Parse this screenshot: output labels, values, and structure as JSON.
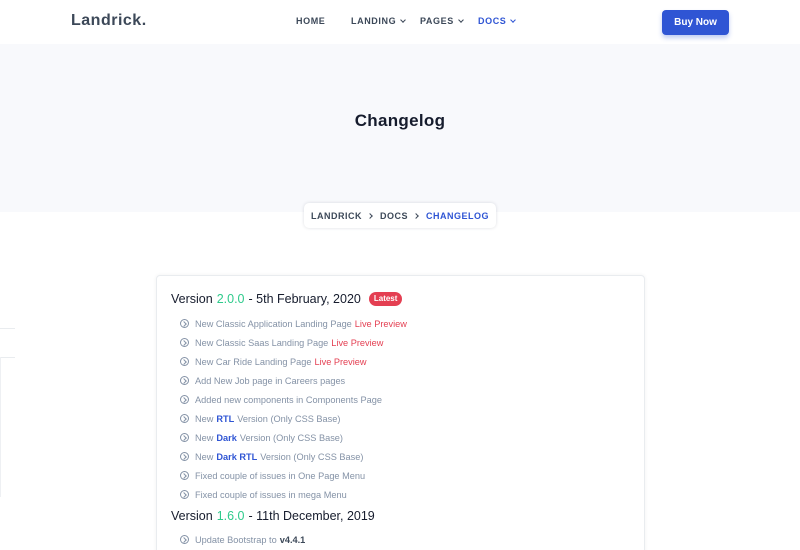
{
  "header": {
    "logo": "Landrick.",
    "nav": [
      {
        "label": "HOME"
      },
      {
        "label": "LANDING"
      },
      {
        "label": "PAGES"
      },
      {
        "label": "DOCS"
      }
    ],
    "buy_label": "Buy Now"
  },
  "hero": {
    "title": "Changelog",
    "breadcrumb": [
      "LANDRICK",
      "DOCS",
      "CHANGELOG"
    ]
  },
  "colors": {
    "accent": "#2f55d4",
    "version_green": "#2eca8b",
    "live_red": "#e43f52",
    "hero_bg": "#f8f9fc"
  },
  "versions": [
    {
      "prefix": "Version",
      "number": "2.0.0",
      "date": "- 5th February, 2020",
      "badge": "Latest",
      "items": [
        {
          "text": "New Classic Application Landing Page",
          "link": "Live Preview"
        },
        {
          "text": "New Classic Saas Landing Page",
          "link": "Live Preview"
        },
        {
          "text": "New Car Ride Landing Page",
          "link": "Live Preview"
        },
        {
          "text": "Add New Job page in Careers pages"
        },
        {
          "text": "Added new components in Components Page"
        },
        {
          "before": "New",
          "highlight": "RTL",
          "after": "Version (Only CSS Base)"
        },
        {
          "before": "New",
          "highlight": "Dark",
          "after": "Version (Only CSS Base)"
        },
        {
          "before": "New",
          "highlight": "Dark RTL",
          "after": "Version (Only CSS Base)"
        },
        {
          "text": "Fixed couple of issues in One Page Menu"
        },
        {
          "text": "Fixed couple of issues in mega Menu"
        }
      ]
    },
    {
      "prefix": "Version",
      "number": "1.6.0",
      "date": "- 11th December, 2019",
      "items": [
        {
          "text": "Update Bootstrap to",
          "strong": "v4.4.1"
        }
      ]
    }
  ]
}
